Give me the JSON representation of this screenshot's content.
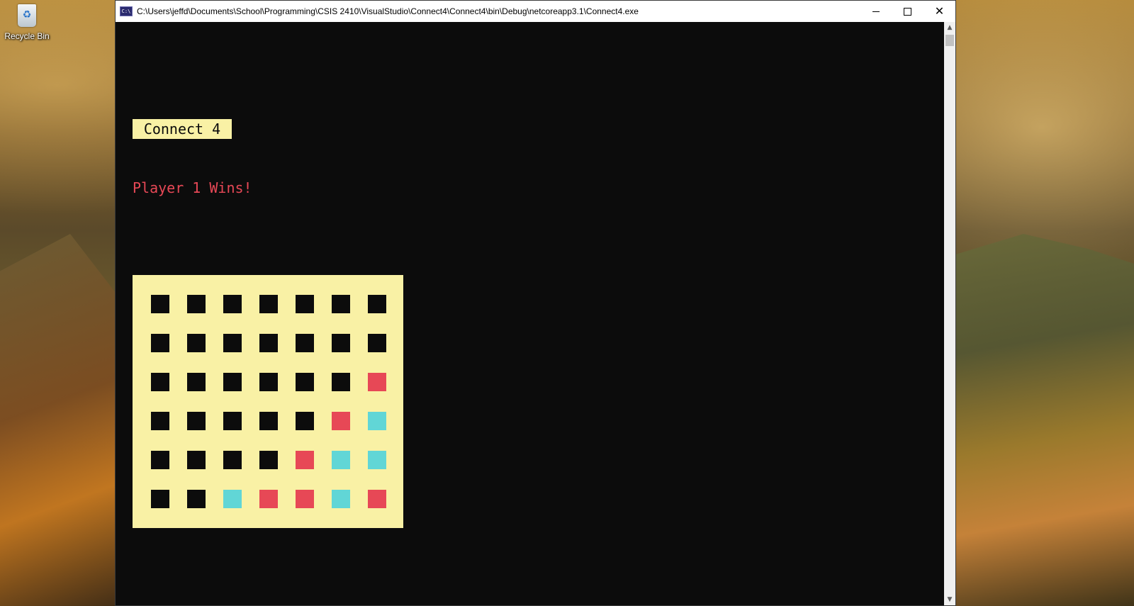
{
  "desktop": {
    "recycle_bin_label": "Recycle Bin"
  },
  "window": {
    "title": "C:\\Users\\jeffd\\Documents\\School\\Programming\\CSIS 2410\\VisualStudio\\Connect4\\Connect4\\bin\\Debug\\netcoreapp3.1\\Connect4.exe",
    "app_icon_text": "C:\\",
    "minimize_icon": "minimize-icon",
    "maximize_icon": "maximize-icon",
    "close_icon": "close-icon"
  },
  "game": {
    "title": "Connect 4",
    "status": "Player 1 Wins!",
    "colors": {
      "empty": "#0c0c0c",
      "player1": "#e74856",
      "player2": "#61d6d6",
      "board": "#f9f1a5",
      "text_red": "#e74856"
    },
    "board": [
      [
        "empty",
        "empty",
        "empty",
        "empty",
        "empty",
        "empty",
        "empty"
      ],
      [
        "empty",
        "empty",
        "empty",
        "empty",
        "empty",
        "empty",
        "empty"
      ],
      [
        "empty",
        "empty",
        "empty",
        "empty",
        "empty",
        "empty",
        "player1"
      ],
      [
        "empty",
        "empty",
        "empty",
        "empty",
        "empty",
        "player1",
        "player2"
      ],
      [
        "empty",
        "empty",
        "empty",
        "empty",
        "player1",
        "player2",
        "player2"
      ],
      [
        "empty",
        "empty",
        "player2",
        "player1",
        "player1",
        "player2",
        "player1"
      ]
    ]
  }
}
